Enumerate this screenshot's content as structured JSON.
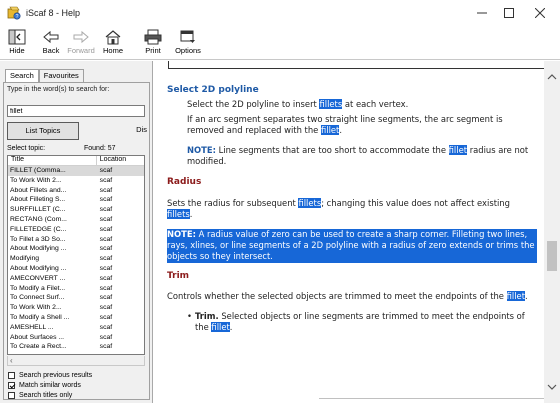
{
  "window": {
    "title": "iScaf 8 - Help",
    "colors": {
      "highlight": "#1767d7",
      "heading_red": "#8b1a1a",
      "heading_blue": "#1f5aa6"
    }
  },
  "toolbar": {
    "hide": "Hide",
    "back": "Back",
    "forward": "Forward",
    "home": "Home",
    "print": "Print",
    "options": "Options"
  },
  "left_pane": {
    "tabs": [
      "Search",
      "Favourites"
    ],
    "hint": "Type in the word(s) to search for:",
    "search_value": "fillet",
    "list_topics_button": "List Topics",
    "display_button": "Dis",
    "select_topic_label": "Select topic:",
    "found_label": "Found: 57",
    "columns": [
      "Title",
      "Location"
    ],
    "results": [
      {
        "title": "FILLET (Comma...",
        "location": "scaf"
      },
      {
        "title": "To Work With 2...",
        "location": "scaf"
      },
      {
        "title": "About Fillets and...",
        "location": "scaf"
      },
      {
        "title": "About Filleting S...",
        "location": "scaf"
      },
      {
        "title": "SURFFILLET (C...",
        "location": "scaf"
      },
      {
        "title": "RECTANG (Com...",
        "location": "scaf"
      },
      {
        "title": "FILLETEDGE (C...",
        "location": "scaf"
      },
      {
        "title": "To Fillet a 3D So...",
        "location": "scaf"
      },
      {
        "title": "About Modifying ...",
        "location": "scaf"
      },
      {
        "title": "Modifying",
        "location": "scaf"
      },
      {
        "title": "About Modifying ...",
        "location": "scaf"
      },
      {
        "title": "AMECONVERT ...",
        "location": "scaf"
      },
      {
        "title": "To Modify a Filet...",
        "location": "scaf"
      },
      {
        "title": "To Connect Surf...",
        "location": "scaf"
      },
      {
        "title": "To Work With 2...",
        "location": "scaf"
      },
      {
        "title": "To Modify a Shell ...",
        "location": "scaf"
      },
      {
        "title": "AMESHELL ...",
        "location": "scaf"
      },
      {
        "title": "About Surfaces ...",
        "location": "scaf"
      },
      {
        "title": "To Create a Rect...",
        "location": "scaf"
      }
    ],
    "checkboxes": [
      {
        "label": "Search previous results",
        "checked": false
      },
      {
        "label": "Match similar words",
        "checked": true
      },
      {
        "label": "Search titles only",
        "checked": false
      }
    ]
  },
  "content": {
    "s1_heading": "Select 2D polyline",
    "s1_p1a": "Select the 2D polyline to insert ",
    "s1_p1_hl": "fillets",
    "s1_p1b": " at each vertex.",
    "s1_p2a": "If an arc segment separates two straight line segments, the arc segment is removed and replaced with the ",
    "s1_p2_hl": "fillet",
    "s1_p2b": ".",
    "s1_note_label": "NOTE:",
    "s1_note_a": " Line segments that are too short to accommodate the ",
    "s1_note_hl": "fillet",
    "s1_note_b": " radius are not modified.",
    "s2_heading": "Radius",
    "s2_p1a": "Sets the radius for subsequent ",
    "s2_p1_hl1": "fillets",
    "s2_p1b": "; changing this value does not affect existing ",
    "s2_p1_hl2": "fillets",
    "s2_p1c": ".",
    "s2_note_label": "NOTE:",
    "s2_note_a": " A radius value of zero can be used to create a sharp corner. ",
    "s2_note_hl": "Filleting",
    "s2_note_b": " two lines, rays, xlines, or line segments of a 2D polyline with a radius of zero extends or trims the objects so they intersect.",
    "s3_heading": "Trim",
    "s3_p1a": "Controls whether the selected objects are trimmed to meet the endpoints of the ",
    "s3_p1_hl": "fillet",
    "s3_p1b": ".",
    "s3_bullet": "•",
    "s3_b1_label": "Trim.",
    "s3_b1a": " Selected objects or line segments are trimmed to meet the endpoints of the ",
    "s3_b1_hl": "fillet",
    "s3_b1b": "."
  }
}
